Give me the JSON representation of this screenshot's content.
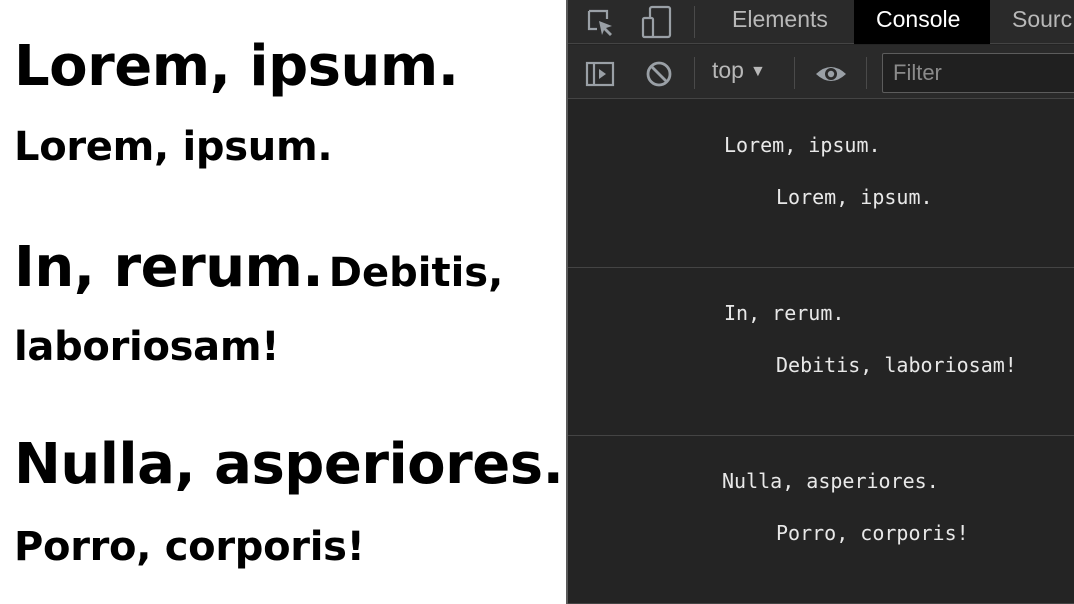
{
  "page": {
    "blocks": [
      {
        "heading": "Lorem, ipsum.",
        "sub": "Lorem, ipsum."
      },
      {
        "heading": "In, rerum.",
        "sub_line1": "Debitis,",
        "sub_line2": "laboriosam!"
      },
      {
        "heading": "Nulla, asperiores.",
        "sub": "Porro, corporis!"
      }
    ]
  },
  "devtools": {
    "tabs": [
      {
        "label": "Elements"
      },
      {
        "label": "Console"
      },
      {
        "label": "Sourc"
      }
    ],
    "active_tab": "Console",
    "context": "top",
    "filter_placeholder": "Filter",
    "messages": [
      {
        "line1": "Lorem, ipsum.",
        "line2": "Lorem, ipsum."
      },
      {
        "line1": "In, rerum.",
        "line2": "Debitis, laboriosam!"
      },
      {
        "line1": "Nulla, asperiores.",
        "line2": "Porro, corporis!"
      }
    ],
    "icons": [
      "inspect-element-icon",
      "device-toolbar-icon",
      "sidebar-toggle-icon",
      "clear-console-icon",
      "live-expression-eye-icon",
      "context-dropdown-caret-icon"
    ],
    "colors": {
      "panel_bg": "#242424",
      "active_tab_bg": "#000000",
      "text": "#e8e8e8"
    }
  }
}
